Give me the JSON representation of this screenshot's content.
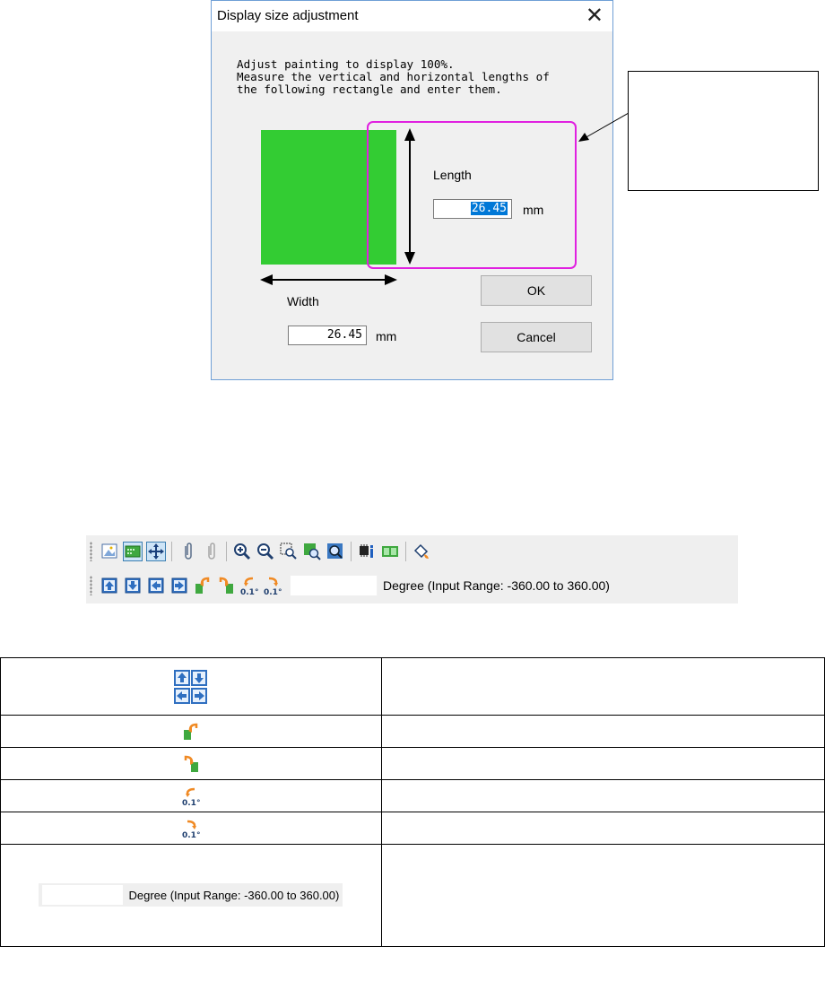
{
  "dialog": {
    "title": "Display size adjustment",
    "close_symbol": "✕",
    "instructions": [
      "Adjust painting to display 100%.",
      "Measure the vertical and horizontal lengths of",
      "the following rectangle and enter them."
    ],
    "length_label": "Length",
    "length_value": "26.45",
    "length_unit": "mm",
    "width_label": "Width",
    "width_value": "26.45",
    "width_unit": "mm",
    "ok_label": "OK",
    "cancel_label": "Cancel",
    "rect_color": "#33cc33",
    "highlight_color": "#e020e0"
  },
  "callout": {
    "text": ""
  },
  "toolbar": {
    "row1_icons": [
      "image-icon",
      "display-grid-icon",
      "move-arrows-icon",
      "paperclip-icon",
      "paperclip-gray-icon",
      "zoom-in-icon",
      "zoom-out-icon",
      "zoom-area-icon",
      "zoom-green-icon",
      "zoom-fit-icon",
      "chip-info-icon",
      "green-double-icon",
      "paint-bucket-icon"
    ],
    "row2_icons": [
      "move-up-icon",
      "move-down-icon",
      "move-left-icon",
      "move-right-icon",
      "rotate-left-90-icon",
      "rotate-right-90-icon",
      "rotate-left-0.1-icon",
      "rotate-right-0.1-icon"
    ],
    "degree_value": "",
    "degree_label": "Degree (Input Range: -360.00 to 360.00)"
  },
  "table": {
    "rows": [
      {
        "icons": [
          "move-up-icon",
          "move-down-icon",
          "move-left-icon",
          "move-right-icon"
        ],
        "description": ""
      },
      {
        "icons": [
          "rotate-left-90-icon"
        ],
        "description": ""
      },
      {
        "icons": [
          "rotate-right-90-icon"
        ],
        "description": ""
      },
      {
        "icons": [
          "rotate-left-0.1-icon"
        ],
        "description": ""
      },
      {
        "icons": [
          "rotate-right-0.1-icon"
        ],
        "description": ""
      },
      {
        "icons": [
          "degree-input"
        ],
        "label": "Degree (Input Range: -360.00 to 360.00)",
        "description": ""
      }
    ]
  },
  "icon_text": {
    "deg01": "0.1°"
  }
}
